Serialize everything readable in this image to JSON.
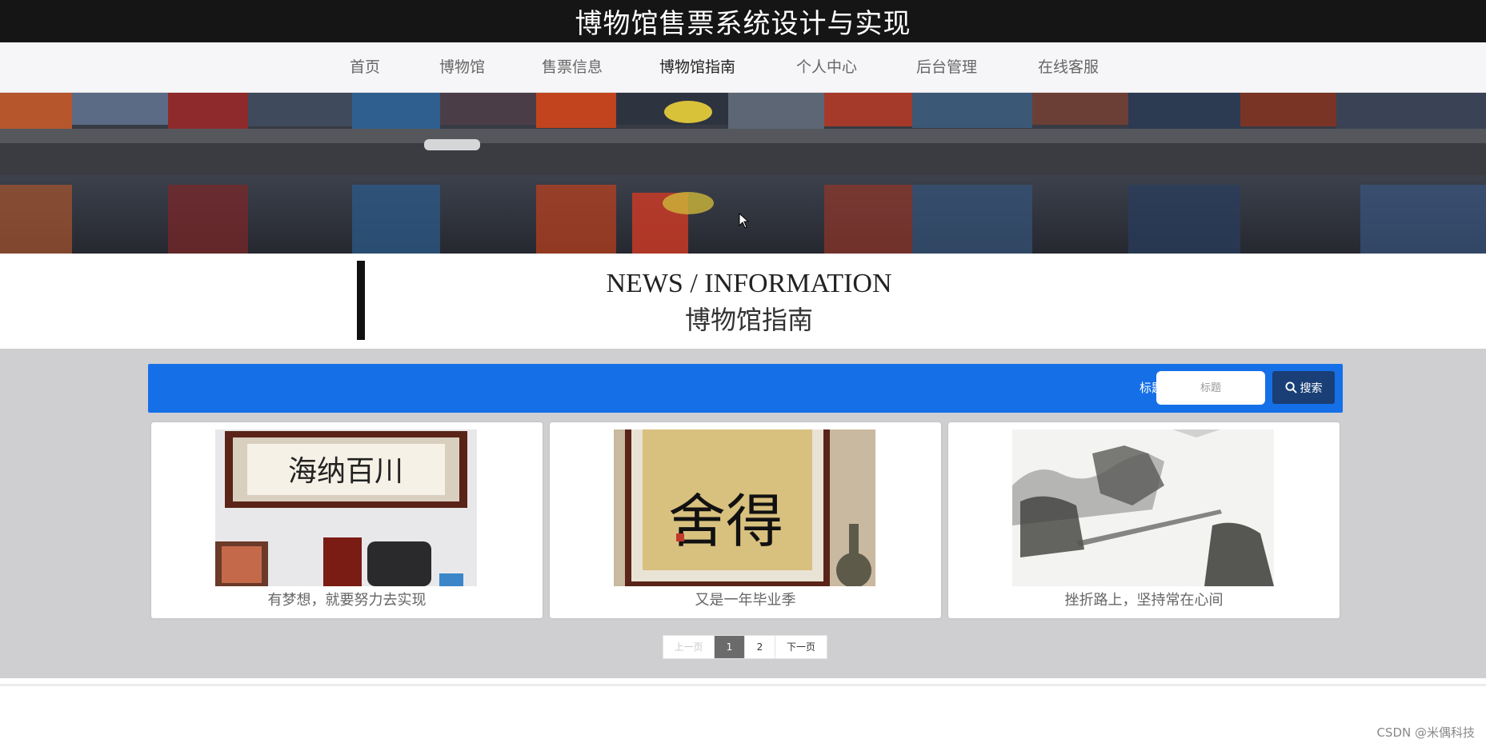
{
  "header": {
    "title": "博物馆售票系统设计与实现"
  },
  "nav": {
    "items": [
      {
        "label": "首页"
      },
      {
        "label": "博物馆"
      },
      {
        "label": "售票信息"
      },
      {
        "label": "博物馆指南",
        "active": true
      },
      {
        "label": "个人中心"
      },
      {
        "label": "后台管理"
      },
      {
        "label": "在线客服"
      }
    ]
  },
  "banner": {
    "icon": "chevron-right-icon"
  },
  "section": {
    "title_en": "NEWS / INFORMATION",
    "title_cn": "博物馆指南"
  },
  "search": {
    "label": "标题",
    "placeholder": "标题",
    "button_label": "搜索",
    "icon": "search-icon"
  },
  "cards": [
    {
      "title": "有梦想，就要努力去实现",
      "image_text": "海纳百川"
    },
    {
      "title": "又是一年毕业季",
      "image_text": "舍得"
    },
    {
      "title": "挫折路上，坚持常在心间",
      "image_text": ""
    }
  ],
  "pagination": {
    "prev": "上一页",
    "pages": [
      "1",
      "2"
    ],
    "current": "1",
    "next": "下一页"
  },
  "watermark": "CSDN @米偶科技",
  "colors": {
    "top_bar": "#151515",
    "search_bar": "#1570e8",
    "search_button": "#1a3f76",
    "content_bg": "#cfcfd1"
  }
}
